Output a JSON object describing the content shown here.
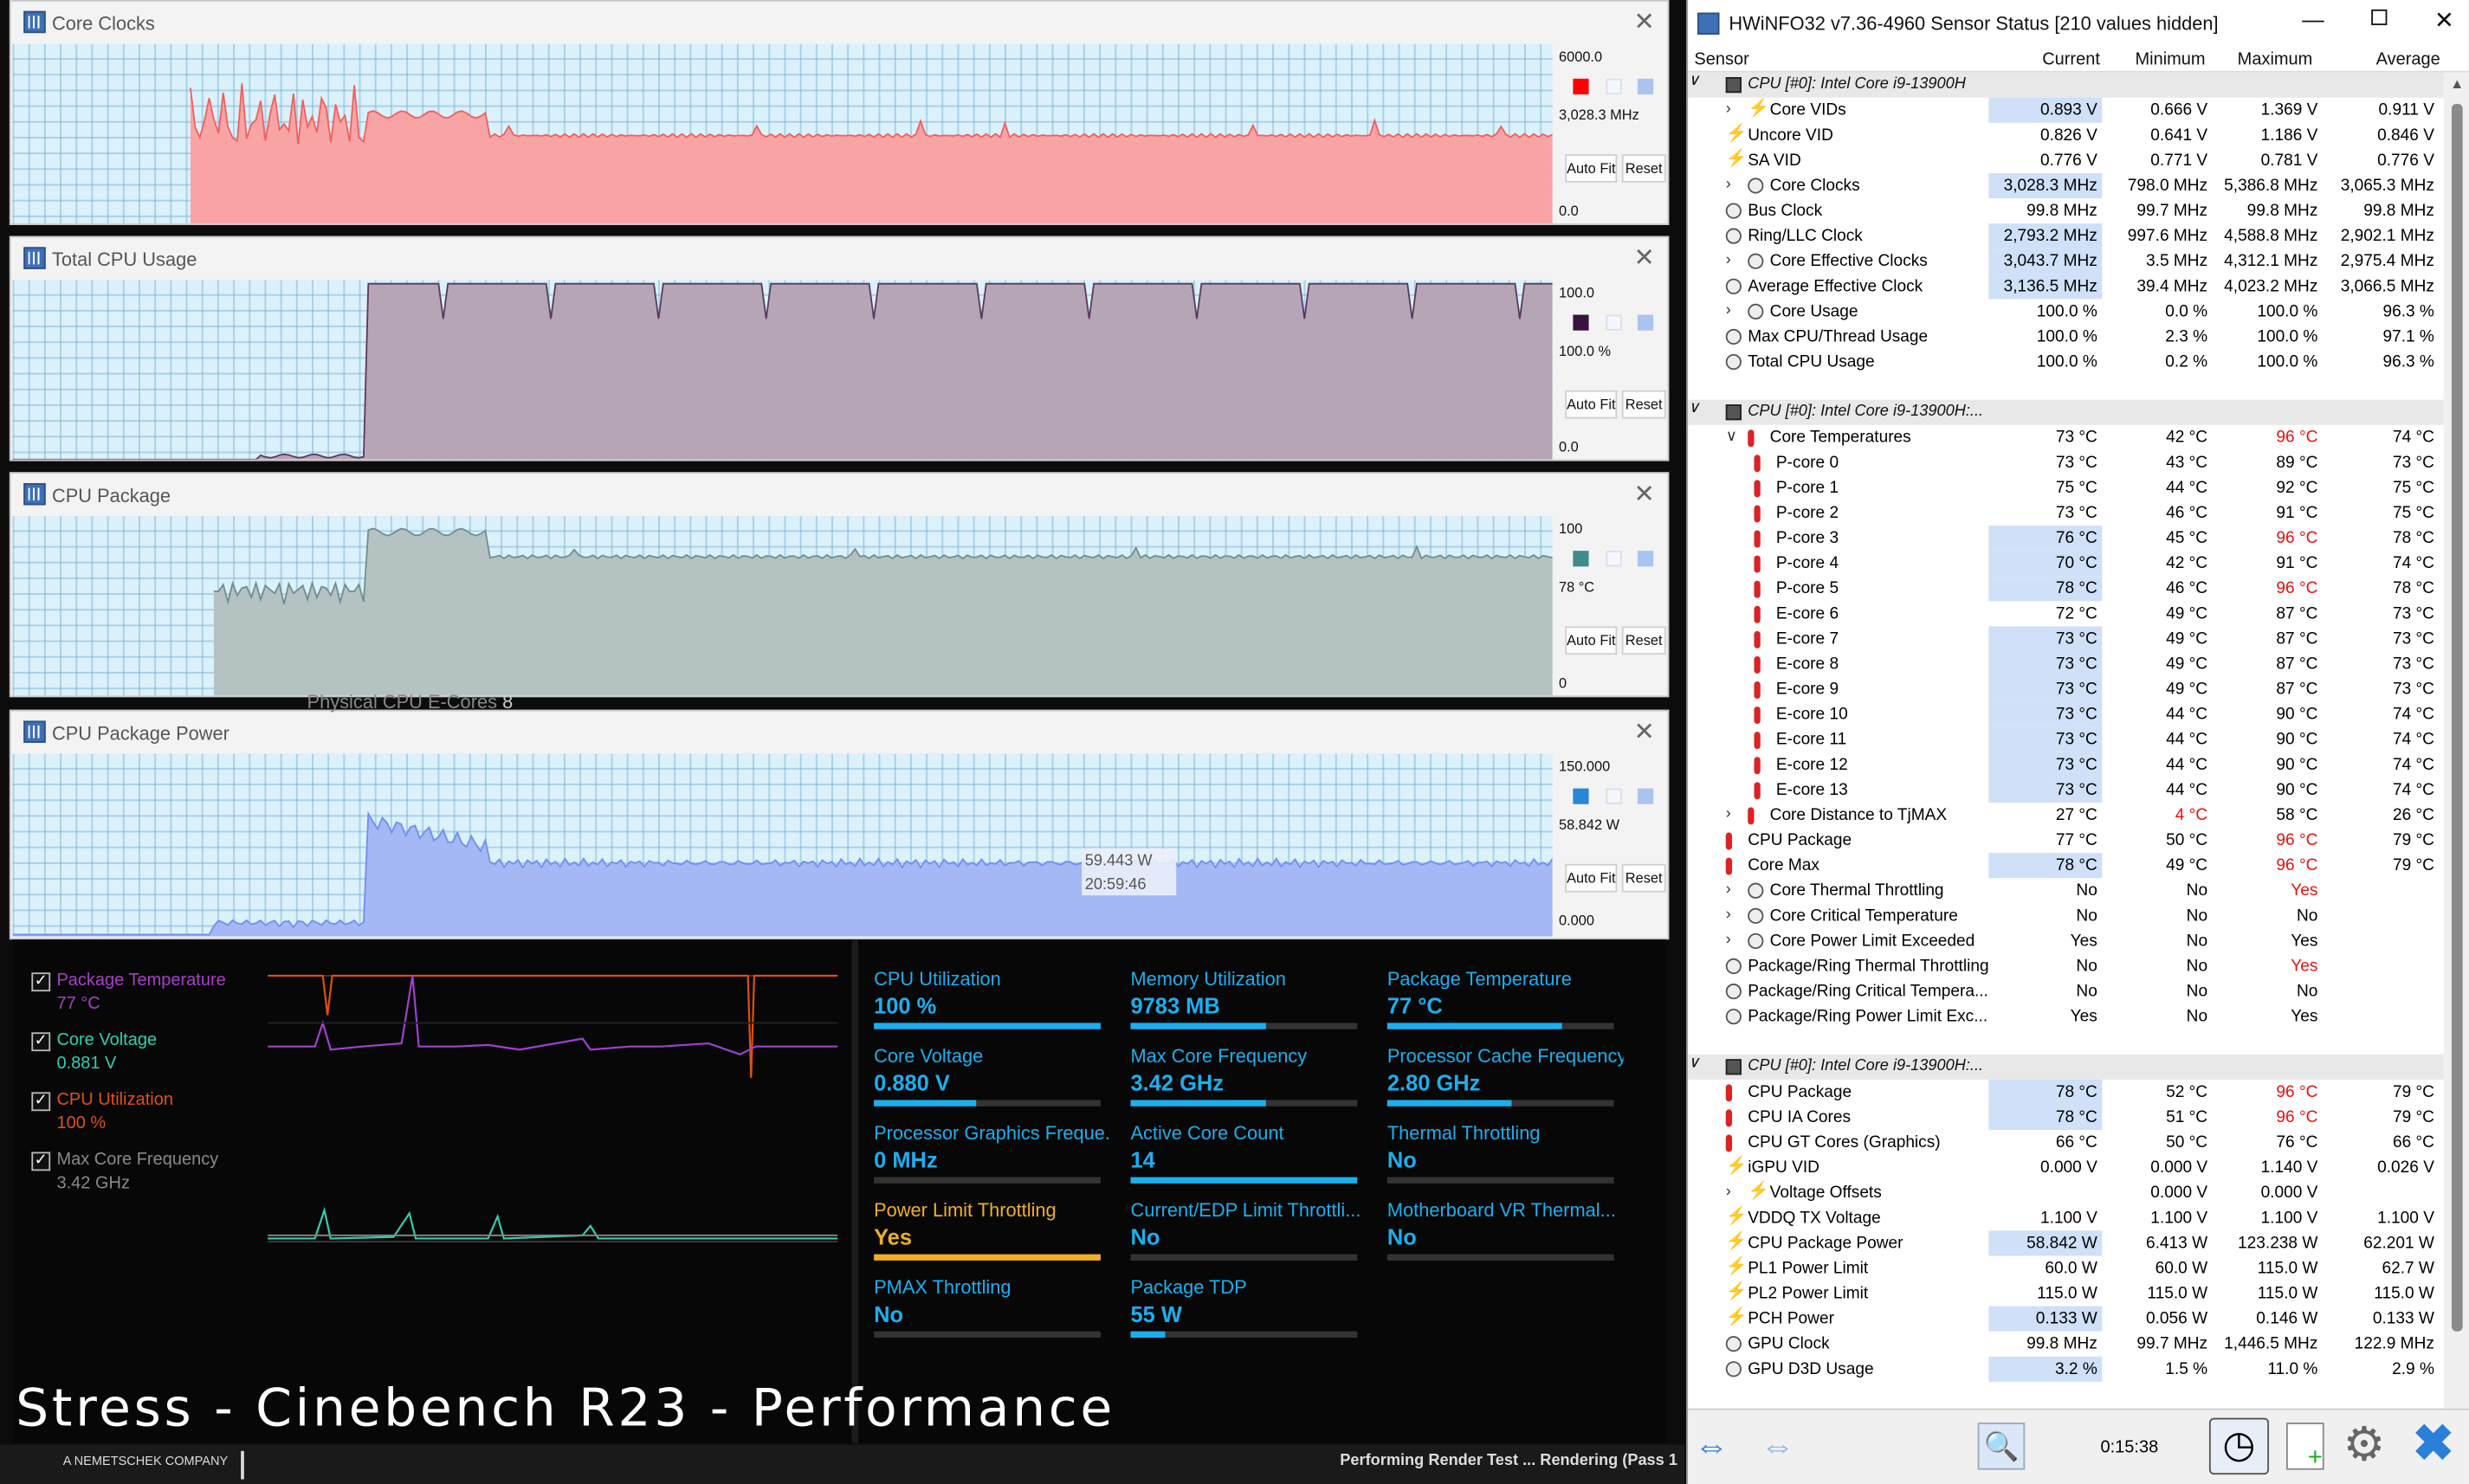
{
  "graphs": [
    {
      "title": "Core Clocks",
      "top": "6000.0",
      "cur": "3,028.3 MHz",
      "bottom": "0.0",
      "color": "#ff0000",
      "fill": "#f9a4a4",
      "stroke": "#f06060",
      "auto": "Auto Fit",
      "reset": "Reset"
    },
    {
      "title": "Total CPU Usage",
      "top": "100.0",
      "cur": "100.0 %",
      "bottom": "0.0",
      "color": "#3a1240",
      "fill": "#b6a5b6",
      "stroke": "#5a3a5e",
      "auto": "Auto Fit",
      "reset": "Reset"
    },
    {
      "title": "CPU Package",
      "top": "100",
      "cur": "78 °C",
      "bottom": "0",
      "color": "#3f8a8a",
      "fill": "#b5c2c2",
      "stroke": "#6f8f8f",
      "auto": "Auto Fit",
      "reset": "Reset"
    },
    {
      "title": "CPU Package Power",
      "top": "150.000",
      "cur": "58.842 W",
      "bottom": "0.000",
      "color": "#2a86d6",
      "fill": "#a3b8f4",
      "stroke": "#6f8ff0",
      "auto": "Auto Fit",
      "reset": "Reset"
    }
  ],
  "tooltip": {
    "value": "59.443 W",
    "time": "20:59:46"
  },
  "background_text": {
    "physical_ecores": "Physical CPU E-Cores",
    "ecore_count": "8"
  },
  "legend": [
    {
      "name": "Package Temperature",
      "value": "77 °C",
      "color": "#a640c8"
    },
    {
      "name": "Core Voltage",
      "value": "0.881 V",
      "color": "#2fd0b0"
    },
    {
      "name": "CPU Utilization",
      "value": "100 %",
      "color": "#e0501a"
    },
    {
      "name": "Max Core Frequency",
      "value": "3.42 GHz",
      "color": "#8a8a8a"
    }
  ],
  "tiles": [
    {
      "name": "CPU Utilization",
      "value": "100 %",
      "pct": 1.0,
      "color": "#1ab0f0"
    },
    {
      "name": "Memory Utilization",
      "value": "9783  MB",
      "pct": 0.6,
      "color": "#1ab0f0"
    },
    {
      "name": "Package Temperature",
      "value": "77 °C",
      "pct": 0.77,
      "color": "#1ab0f0"
    },
    {
      "name": "Core Voltage",
      "value": "0.880 V",
      "pct": 0.45,
      "color": "#1ab0f0"
    },
    {
      "name": "Max Core Frequency",
      "value": "3.42 GHz",
      "pct": 0.6,
      "color": "#1ab0f0"
    },
    {
      "name": "Processor Cache Frequency",
      "value": "2.80 GHz",
      "pct": 0.55,
      "color": "#1ab0f0"
    },
    {
      "name": "Processor Graphics Freque...",
      "value": "0 MHz",
      "pct": 0.0,
      "color": "#1ab0f0"
    },
    {
      "name": "Active Core Count",
      "value": "14",
      "pct": 1.0,
      "color": "#1ab0f0"
    },
    {
      "name": "Thermal Throttling",
      "value": "No",
      "pct": 0.0,
      "color": "#1ab0f0"
    },
    {
      "name": "Power Limit Throttling",
      "value": "Yes",
      "pct": 1.0,
      "color": "#f0b020"
    },
    {
      "name": "Current/EDP Limit Throttli...",
      "value": "No",
      "pct": 0.0,
      "color": "#1ab0f0"
    },
    {
      "name": "Motherboard VR Thermal...",
      "value": "No",
      "pct": 0.0,
      "color": "#1ab0f0"
    },
    {
      "name": "PMAX Throttling",
      "value": "No",
      "pct": 0.0,
      "color": "#1ab0f0"
    },
    {
      "name": "Package TDP",
      "value": "55 W",
      "pct": 0.15,
      "color": "#1ab0f0"
    }
  ],
  "overlay_title": "Stress - Cinebench R23 - Performance",
  "bottom": {
    "company": "A NEMETSCHEK COMPANY",
    "status": "Performing Render Test ... Rendering (Pass 1"
  },
  "hw": {
    "title": "HWiNFO32 v7.36-4960 Sensor Status [210 values hidden]",
    "headers": [
      "Sensor",
      "Current",
      "Minimum",
      "Maximum",
      "Average"
    ],
    "time": "0:15:38",
    "rows": [
      {
        "t": "g",
        "name": "CPU [#0]: Intel Core i9-13900H",
        "exp": "v"
      },
      {
        "name": "Core VIDs",
        "vals": [
          "0.893 V",
          "0.666 V",
          "1.369 V",
          "0.911 V"
        ],
        "ic": "volt",
        "ind": 2,
        "exp": ">",
        "hl": true
      },
      {
        "name": "Uncore VID",
        "vals": [
          "0.826 V",
          "0.641 V",
          "1.186 V",
          "0.846 V"
        ],
        "ic": "volt",
        "ind": 1
      },
      {
        "name": "SA VID",
        "vals": [
          "0.776 V",
          "0.771 V",
          "0.781 V",
          "0.776 V"
        ],
        "ic": "volt",
        "ind": 1
      },
      {
        "name": "Core Clocks",
        "vals": [
          "3,028.3 MHz",
          "798.0 MHz",
          "5,386.8 MHz",
          "3,065.3 MHz"
        ],
        "ic": "clock",
        "ind": 2,
        "exp": ">",
        "hl": true
      },
      {
        "name": "Bus Clock",
        "vals": [
          "99.8 MHz",
          "99.7 MHz",
          "99.8 MHz",
          "99.8 MHz"
        ],
        "ic": "clock",
        "ind": 1
      },
      {
        "name": "Ring/LLC Clock",
        "vals": [
          "2,793.2 MHz",
          "997.6 MHz",
          "4,588.8 MHz",
          "2,902.1 MHz"
        ],
        "ic": "clock",
        "ind": 1,
        "hl": true
      },
      {
        "name": "Core Effective Clocks",
        "vals": [
          "3,043.7 MHz",
          "3.5 MHz",
          "4,312.1 MHz",
          "2,975.4 MHz"
        ],
        "ic": "clock",
        "ind": 2,
        "exp": ">",
        "hl": true
      },
      {
        "name": "Average Effective Clock",
        "vals": [
          "3,136.5 MHz",
          "39.4 MHz",
          "4,023.2 MHz",
          "3,066.5 MHz"
        ],
        "ic": "clock",
        "ind": 1,
        "hl": true
      },
      {
        "name": "Core Usage",
        "vals": [
          "100.0 %",
          "0.0 %",
          "100.0 %",
          "96.3 %"
        ],
        "ic": "clock",
        "ind": 2,
        "exp": ">"
      },
      {
        "name": "Max CPU/Thread Usage",
        "vals": [
          "100.0 %",
          "2.3 %",
          "100.0 %",
          "97.1 %"
        ],
        "ic": "clock",
        "ind": 1
      },
      {
        "name": "Total CPU Usage",
        "vals": [
          "100.0 %",
          "0.2 %",
          "100.0 %",
          "96.3 %"
        ],
        "ic": "clock",
        "ind": 1
      },
      {
        "t": "s"
      },
      {
        "t": "g",
        "name": "CPU [#0]: Intel Core i9-13900H:...",
        "exp": "v"
      },
      {
        "name": "Core Temperatures",
        "vals": [
          "73 °C",
          "42 °C",
          "96 °C",
          "74 °C"
        ],
        "ic": "temp",
        "ind": 2,
        "exp": "v",
        "red": [
          2
        ]
      },
      {
        "name": "P-core 0",
        "vals": [
          "73 °C",
          "43 °C",
          "89 °C",
          "73 °C"
        ],
        "ic": "temp",
        "ind": 3
      },
      {
        "name": "P-core 1",
        "vals": [
          "75 °C",
          "44 °C",
          "92 °C",
          "75 °C"
        ],
        "ic": "temp",
        "ind": 3
      },
      {
        "name": "P-core 2",
        "vals": [
          "73 °C",
          "46 °C",
          "91 °C",
          "75 °C"
        ],
        "ic": "temp",
        "ind": 3
      },
      {
        "name": "P-core 3",
        "vals": [
          "76 °C",
          "45 °C",
          "96 °C",
          "78 °C"
        ],
        "ic": "temp",
        "ind": 3,
        "hl": true,
        "red": [
          2
        ]
      },
      {
        "name": "P-core 4",
        "vals": [
          "70 °C",
          "42 °C",
          "91 °C",
          "74 °C"
        ],
        "ic": "temp",
        "ind": 3,
        "hl": true
      },
      {
        "name": "P-core 5",
        "vals": [
          "78 °C",
          "46 °C",
          "96 °C",
          "78 °C"
        ],
        "ic": "temp",
        "ind": 3,
        "hl": true,
        "red": [
          2
        ]
      },
      {
        "name": "E-core 6",
        "vals": [
          "72 °C",
          "49 °C",
          "87 °C",
          "73 °C"
        ],
        "ic": "temp",
        "ind": 3
      },
      {
        "name": "E-core 7",
        "vals": [
          "73 °C",
          "49 °C",
          "87 °C",
          "73 °C"
        ],
        "ic": "temp",
        "ind": 3,
        "hl": true
      },
      {
        "name": "E-core 8",
        "vals": [
          "73 °C",
          "49 °C",
          "87 °C",
          "73 °C"
        ],
        "ic": "temp",
        "ind": 3,
        "hl": true
      },
      {
        "name": "E-core 9",
        "vals": [
          "73 °C",
          "49 °C",
          "87 °C",
          "73 °C"
        ],
        "ic": "temp",
        "ind": 3,
        "hl": true
      },
      {
        "name": "E-core 10",
        "vals": [
          "73 °C",
          "44 °C",
          "90 °C",
          "74 °C"
        ],
        "ic": "temp",
        "ind": 3,
        "hl": true
      },
      {
        "name": "E-core 11",
        "vals": [
          "73 °C",
          "44 °C",
          "90 °C",
          "74 °C"
        ],
        "ic": "temp",
        "ind": 3,
        "hl": true
      },
      {
        "name": "E-core 12",
        "vals": [
          "73 °C",
          "44 °C",
          "90 °C",
          "74 °C"
        ],
        "ic": "temp",
        "ind": 3,
        "hl": true
      },
      {
        "name": "E-core 13",
        "vals": [
          "73 °C",
          "44 °C",
          "90 °C",
          "74 °C"
        ],
        "ic": "temp",
        "ind": 3,
        "hl": true
      },
      {
        "name": "Core Distance to TjMAX",
        "vals": [
          "27 °C",
          "4 °C",
          "58 °C",
          "26 °C"
        ],
        "ic": "temp",
        "ind": 2,
        "exp": ">",
        "red": [
          1
        ]
      },
      {
        "name": "CPU Package",
        "vals": [
          "77 °C",
          "50 °C",
          "96 °C",
          "79 °C"
        ],
        "ic": "temp",
        "ind": 1,
        "red": [
          2
        ]
      },
      {
        "name": "Core Max",
        "vals": [
          "78 °C",
          "49 °C",
          "96 °C",
          "79 °C"
        ],
        "ic": "temp",
        "ind": 1,
        "hl": true,
        "red": [
          2
        ]
      },
      {
        "name": "Core Thermal Throttling",
        "vals": [
          "No",
          "No",
          "Yes",
          ""
        ],
        "ic": "clock",
        "ind": 2,
        "exp": ">",
        "red": [
          2
        ]
      },
      {
        "name": "Core Critical Temperature",
        "vals": [
          "No",
          "No",
          "No",
          ""
        ],
        "ic": "clock",
        "ind": 2,
        "exp": ">"
      },
      {
        "name": "Core Power Limit Exceeded",
        "vals": [
          "Yes",
          "No",
          "Yes",
          ""
        ],
        "ic": "clock",
        "ind": 2,
        "exp": ">"
      },
      {
        "name": "Package/Ring Thermal Throttling",
        "vals": [
          "No",
          "No",
          "Yes",
          ""
        ],
        "ic": "clock",
        "ind": 1,
        "red": [
          2
        ]
      },
      {
        "name": "Package/Ring Critical Tempera...",
        "vals": [
          "No",
          "No",
          "No",
          ""
        ],
        "ic": "clock",
        "ind": 1
      },
      {
        "name": "Package/Ring Power Limit Exc...",
        "vals": [
          "Yes",
          "No",
          "Yes",
          ""
        ],
        "ic": "clock",
        "ind": 1
      },
      {
        "t": "s"
      },
      {
        "t": "g",
        "name": "CPU [#0]: Intel Core i9-13900H:...",
        "exp": "v"
      },
      {
        "name": "CPU Package",
        "vals": [
          "78 °C",
          "52 °C",
          "96 °C",
          "79 °C"
        ],
        "ic": "temp",
        "ind": 1,
        "hl": true,
        "red": [
          2
        ]
      },
      {
        "name": "CPU IA Cores",
        "vals": [
          "78 °C",
          "51 °C",
          "96 °C",
          "79 °C"
        ],
        "ic": "temp",
        "ind": 1,
        "hl": true,
        "red": [
          2
        ]
      },
      {
        "name": "CPU GT Cores (Graphics)",
        "vals": [
          "66 °C",
          "50 °C",
          "76 °C",
          "66 °C"
        ],
        "ic": "temp",
        "ind": 1
      },
      {
        "name": "iGPU VID",
        "vals": [
          "0.000 V",
          "0.000 V",
          "1.140 V",
          "0.026 V"
        ],
        "ic": "volt",
        "ind": 1
      },
      {
        "name": "Voltage Offsets",
        "vals": [
          "",
          "0.000 V",
          "0.000 V",
          ""
        ],
        "ic": "volt",
        "ind": 2,
        "exp": ">"
      },
      {
        "name": "VDDQ TX Voltage",
        "vals": [
          "1.100 V",
          "1.100 V",
          "1.100 V",
          "1.100 V"
        ],
        "ic": "volt",
        "ind": 1
      },
      {
        "name": "CPU Package Power",
        "vals": [
          "58.842 W",
          "6.413 W",
          "123.238 W",
          "62.201 W"
        ],
        "ic": "volt",
        "ind": 1,
        "hl": true
      },
      {
        "name": "PL1 Power Limit",
        "vals": [
          "60.0 W",
          "60.0 W",
          "115.0 W",
          "62.7 W"
        ],
        "ic": "volt",
        "ind": 1
      },
      {
        "name": "PL2 Power Limit",
        "vals": [
          "115.0 W",
          "115.0 W",
          "115.0 W",
          "115.0 W"
        ],
        "ic": "volt",
        "ind": 1
      },
      {
        "name": "PCH Power",
        "vals": [
          "0.133 W",
          "0.056 W",
          "0.146 W",
          "0.133 W"
        ],
        "ic": "volt",
        "ind": 1,
        "hl": true
      },
      {
        "name": "GPU Clock",
        "vals": [
          "99.8 MHz",
          "99.7 MHz",
          "1,446.5 MHz",
          "122.9 MHz"
        ],
        "ic": "clock",
        "ind": 1
      },
      {
        "name": "GPU D3D Usage",
        "vals": [
          "3.2 %",
          "1.5 %",
          "11.0 %",
          "2.9 %"
        ],
        "ic": "clock",
        "ind": 1,
        "hl": true
      }
    ]
  }
}
